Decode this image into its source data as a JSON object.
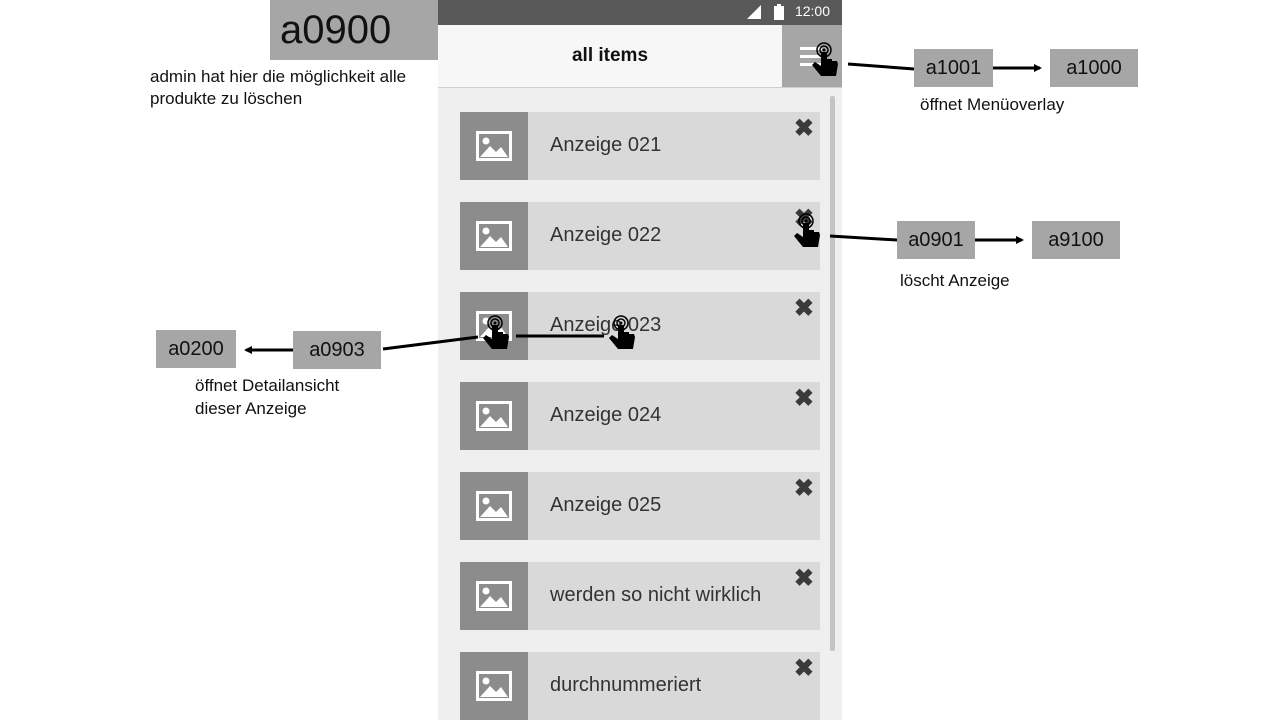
{
  "screen_id": "a0900",
  "screen_description": "admin hat hier die möglichkeit alle produkte zu löschen",
  "status_bar": {
    "time": "12:00"
  },
  "app_bar": {
    "title": "all items",
    "menu_icon": "hamburger-menu-icon"
  },
  "items": [
    {
      "label": "Anzeige 021",
      "image_icon": "image-icon",
      "delete_icon": "close-icon"
    },
    {
      "label": "Anzeige 022",
      "image_icon": "image-icon",
      "delete_icon": "close-icon"
    },
    {
      "label": "Anzeige 023",
      "image_icon": "image-icon",
      "delete_icon": "close-icon"
    },
    {
      "label": "Anzeige 024",
      "image_icon": "image-icon",
      "delete_icon": "close-icon"
    },
    {
      "label": "Anzeige 025",
      "image_icon": "image-icon",
      "delete_icon": "close-icon"
    },
    {
      "label": "werden so nicht wirklich",
      "image_icon": "image-icon",
      "delete_icon": "close-icon"
    },
    {
      "label": "durchnummeriert",
      "image_icon": "image-icon",
      "delete_icon": "close-icon"
    }
  ],
  "annotations": {
    "menu": {
      "action_id": "a1001",
      "target_id": "a1000",
      "description": "öffnet Menüoverlay"
    },
    "delete": {
      "action_id": "a0901",
      "target_id": "a9100",
      "description": "löscht Anzeige"
    },
    "detail": {
      "action_id": "a0903",
      "target_id": "a0200",
      "description_line1": "öffnet Detailansicht",
      "description_line2": "dieser Anzeige"
    }
  },
  "colors": {
    "label_box": "#a6a6a6",
    "status_bar": "#595959",
    "item_bg": "#d9d9d9",
    "thumb_bg": "#8c8c8c"
  }
}
